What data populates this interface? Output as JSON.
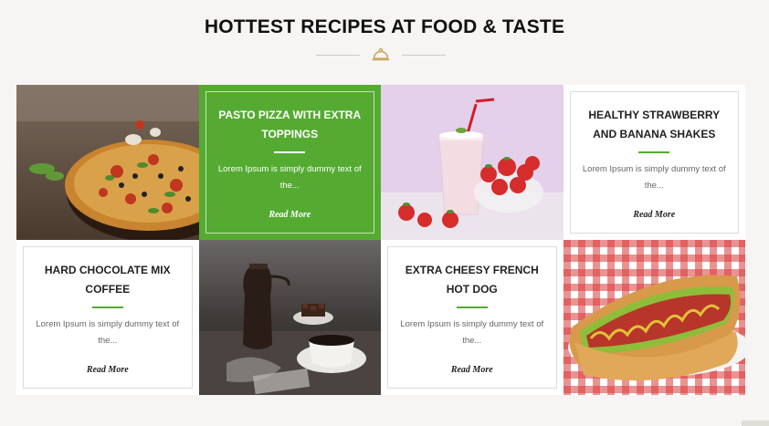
{
  "section": {
    "heading": "HOTTEST RECIPES AT FOOD & TASTE",
    "divider_icon": "cloche-icon",
    "accent_color": "#55ab32",
    "divider_icon_color": "#c9a65a"
  },
  "cards": [
    {
      "title": "PASTO PIZZA WITH EXTRA TOPPINGS",
      "description": "Lorem Ipsum is simply dummy text of the...",
      "link": "Read More",
      "style": "green"
    },
    {
      "title": "HEALTHY STRAWBERRY AND BANANA SHAKES",
      "description": "Lorem Ipsum is simply dummy text of the...",
      "link": "Read More",
      "style": "white"
    },
    {
      "title": "HARD CHOCOLATE MIX COFFEE",
      "description": "Lorem Ipsum is simply dummy text of the...",
      "link": "Read More",
      "style": "white"
    },
    {
      "title": "EXTRA CHEESY FRENCH HOT DOG",
      "description": "Lorem Ipsum is simply dummy text of the...",
      "link": "Read More",
      "style": "white"
    }
  ],
  "photos": [
    {
      "subject": "pizza"
    },
    {
      "subject": "strawberry milkshake"
    },
    {
      "subject": "coffee and chocolate"
    },
    {
      "subject": "hot dog"
    }
  ]
}
